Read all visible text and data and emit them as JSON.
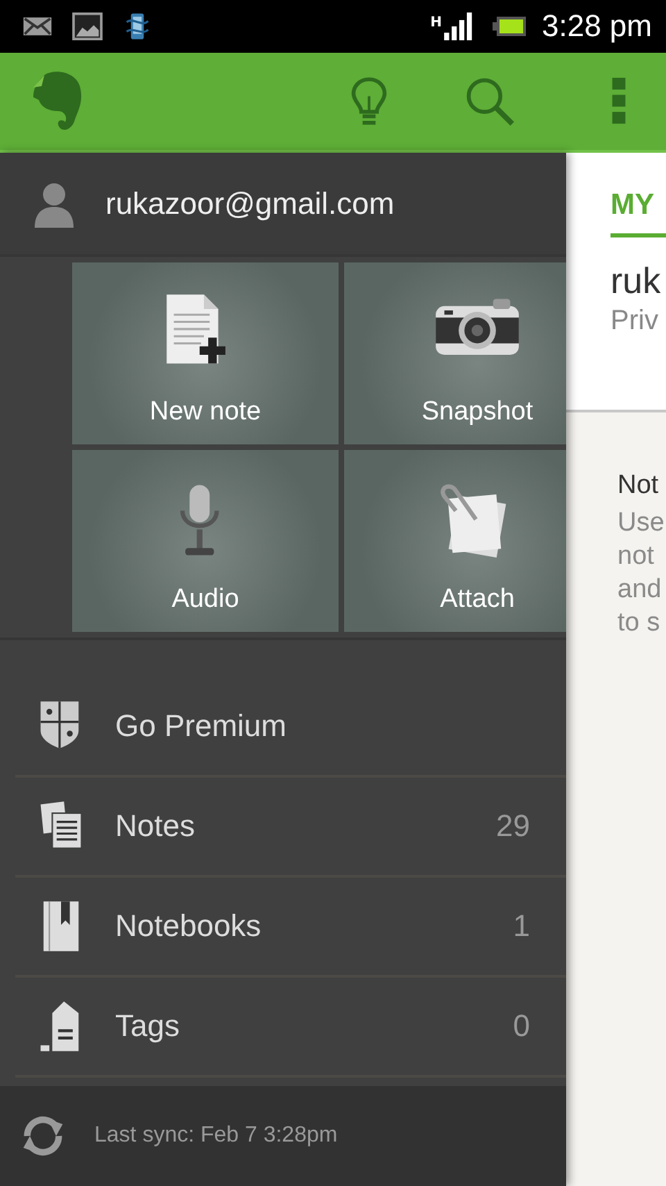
{
  "status_bar": {
    "network": "H",
    "time": "3:28 pm"
  },
  "drawer": {
    "account": "rukazoor@gmail.com",
    "tiles": [
      {
        "label": "New note",
        "kind": "note"
      },
      {
        "label": "Snapshot",
        "kind": "camera"
      },
      {
        "label": "Audio",
        "kind": "audio"
      },
      {
        "label": "Attach",
        "kind": "attach"
      }
    ],
    "items": [
      {
        "label": "Go Premium",
        "kind": "premium"
      },
      {
        "label": "Notes",
        "count": "29",
        "kind": "notes"
      },
      {
        "label": "Notebooks",
        "count": "1",
        "kind": "notebook"
      },
      {
        "label": "Tags",
        "count": "0",
        "kind": "tag"
      }
    ],
    "sync": "Last sync: Feb 7 3:28pm"
  },
  "content": {
    "tabs": [
      {
        "label": "MY",
        "selected": true
      }
    ],
    "title": "ruk",
    "subtitle": "Priv",
    "heading": "Not",
    "body": [
      "Use",
      "not",
      "and",
      "to s"
    ]
  }
}
